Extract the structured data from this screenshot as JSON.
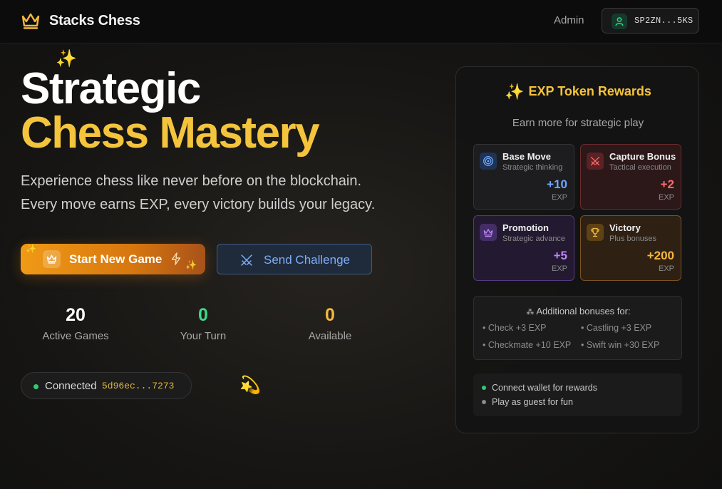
{
  "header": {
    "brand": "Stacks Chess",
    "admin_label": "Admin",
    "wallet_address": "SP2ZN...5KS"
  },
  "hero": {
    "title_line1": "Strategic",
    "title_line2": "Chess Mastery",
    "description_line1": "Experience chess like never before on the blockchain.",
    "description_line2": "Every move earns EXP, every victory builds your legacy.",
    "start_button_label": "Start New Game",
    "challenge_button_label": "Send Challenge"
  },
  "stats": [
    {
      "value": "20",
      "label": "Active Games",
      "color": "#ffffff"
    },
    {
      "value": "0",
      "label": "Your Turn",
      "color": "#3fd98a"
    },
    {
      "value": "0",
      "label": "Available",
      "color": "#f5b83d"
    }
  ],
  "connection": {
    "label": "Connected",
    "address": "5d96ec...7273"
  },
  "rewards": {
    "title": "EXP Token Rewards",
    "subtitle": "Earn more for strategic play",
    "cards": [
      {
        "title": "Base Move",
        "subtitle": "Strategic thinking",
        "value": "+10",
        "unit": "EXP",
        "icon": "target-icon",
        "value_color": "#6ea8ff"
      },
      {
        "title": "Capture Bonus",
        "subtitle": "Tactical execution",
        "value": "+2",
        "unit": "EXP",
        "icon": "swords-icon",
        "value_color": "#ff6b6b"
      },
      {
        "title": "Promotion",
        "subtitle": "Strategic advance",
        "value": "+5",
        "unit": "EXP",
        "icon": "crown-icon",
        "value_color": "#c084fc"
      },
      {
        "title": "Victory",
        "subtitle": "Plus bonuses",
        "value": "+200",
        "unit": "EXP",
        "icon": "trophy-icon",
        "value_color": "#f5b83d"
      }
    ],
    "bonus_heading": "Additional bonuses for:",
    "bonuses": [
      "Check +3 EXP",
      "Castling +3 EXP",
      "Checkmate +10 EXP",
      "Swift win +30 EXP"
    ],
    "info": [
      {
        "text": "Connect wallet for rewards",
        "bullet_color": "#2ecc71"
      },
      {
        "text": "Play as guest for fun",
        "bullet_color": "#8a8a8a"
      }
    ]
  },
  "colors": {
    "accent_gold": "#f5c43d",
    "start_button": "#f09a16",
    "challenge_text": "#7eaef5"
  }
}
